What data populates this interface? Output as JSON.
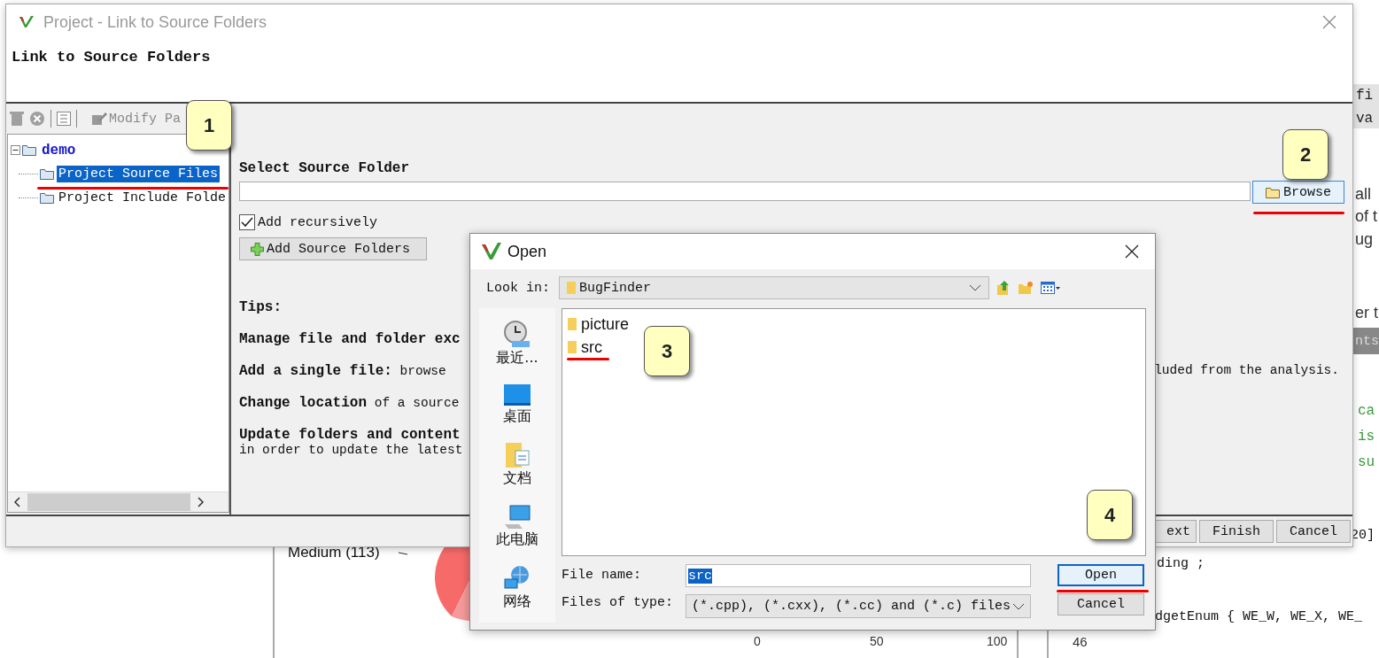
{
  "background": {
    "side_texts": [
      {
        "text": "fi",
        "kind": "header"
      },
      {
        "text": "va",
        "kind": "header"
      },
      {
        "text": "all",
        "kind": "prose"
      },
      {
        "text": "of t",
        "kind": "prose"
      },
      {
        "text": "ug",
        "kind": "prose"
      },
      {
        "text": "er t",
        "kind": "prose"
      },
      {
        "text": "nts",
        "kind": "path"
      },
      {
        "text": "ca",
        "kind": "comment"
      },
      {
        "text": "is",
        "kind": "comment"
      },
      {
        "text": "su",
        "kind": "comment"
      },
      {
        "text": "20]",
        "kind": "code"
      }
    ],
    "code_lines": [
      "ding ;",
      "dgetEnum { WE_W, WE_X, WE_"
    ],
    "chart_label": "Medium (113)",
    "axis_ticks": [
      "0",
      "50",
      "100"
    ],
    "row_number": "46"
  },
  "wizard": {
    "title": "Project - Link to Source Folders",
    "heading": "Link to Source Folders",
    "toolbar": {
      "modify_label": "Modify Pa"
    },
    "tree": {
      "label": "demo",
      "expanded": true,
      "children": [
        {
          "label": "Project Source Files",
          "selected": true
        },
        {
          "label": "Project Include Folde",
          "selected": false
        }
      ]
    },
    "select_label": "Select Source Folder",
    "browse_button": "Browse",
    "recursive": {
      "label": "Add recursively",
      "checked": true
    },
    "add_button": "Add Source Folders",
    "tips_title": "Tips:",
    "tips": [
      {
        "kind": "heading",
        "text": "Manage file and folder exc"
      },
      {
        "kind": "tip",
        "text": "**Add a single file:** browse",
        "right": "luded from the analysis."
      },
      {
        "kind": "tip",
        "text": "**Change location** of a source"
      },
      {
        "kind": "heading",
        "text": "Update folders and content",
        "next": "in order to update the latest"
      }
    ],
    "buttons": [
      "ext",
      "Finish",
      "Cancel"
    ]
  },
  "open_dialog": {
    "title": "Open",
    "look_in_label": "Look in:",
    "look_in_value": "BugFinder",
    "places": [
      {
        "label": "最近...",
        "kind": "recent"
      },
      {
        "label": "桌面",
        "kind": "desktop"
      },
      {
        "label": "文档",
        "kind": "documents"
      },
      {
        "label": "此电脑",
        "kind": "computer"
      },
      {
        "label": "网络",
        "kind": "network"
      }
    ],
    "files": [
      "picture",
      "src"
    ],
    "file_name_label": "File name:",
    "file_name": "src",
    "type_label": "Files of type:",
    "type_value": "(*.cpp), (*.cxx), (*.cc) and (*.c) files",
    "buttons": [
      "Open",
      "Cancel"
    ]
  },
  "callouts": [
    "1",
    "2",
    "3",
    "4"
  ]
}
